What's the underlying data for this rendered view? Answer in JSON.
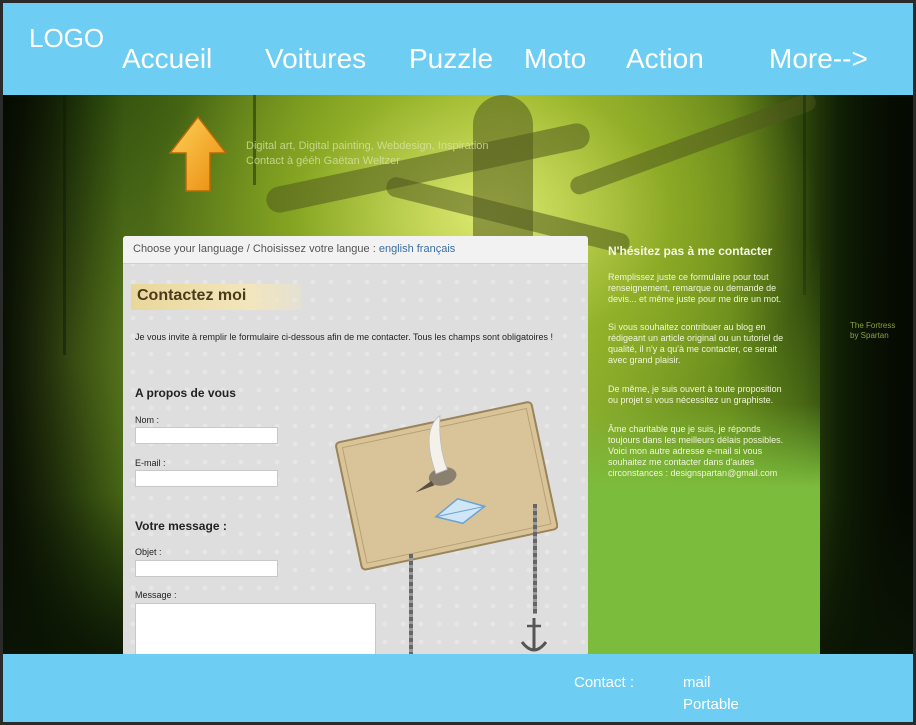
{
  "header": {
    "logo": "LOGO",
    "nav": [
      "Accueil",
      "Voitures",
      "Puzzle",
      "Moto",
      "Action",
      "More-->"
    ]
  },
  "hero": {
    "tagline_line1": "Digital art, Digital painting, Webdesign, Inspiration",
    "tagline_line2": "Contact à gééh Gaëtan Weltzer",
    "credit_line1": "The Fortress",
    "credit_line2": "by Spartan"
  },
  "panel": {
    "lang_prefix": "Choose your language / Choisissez votre langue :",
    "lang_english": "english",
    "lang_french": "français",
    "title": "Contactez moi",
    "intro": "Je vous invite à remplir le formulaire ci-dessous afin de me contacter. Tous les champs sont obligatoires !",
    "section_about": "A propos de vous",
    "label_nom": "Nom :",
    "label_email": "E-mail :",
    "section_message": "Votre message :",
    "label_objet": "Objet :",
    "label_message": "Message :"
  },
  "sidebar": {
    "title": "N'hésitez pas à me contacter",
    "p1": [
      "Remplissez juste ce formulaire pour tout",
      "renseignement, remarque ou demande de",
      "devis... et même juste pour me dire un mot."
    ],
    "p2": [
      "Si vous souhaitez contribuer au blog en",
      "rédigeant un article original ou un tutoriel de",
      "qualité, il n'y a qu'à me contacter, ce serait",
      "avec grand plaisir."
    ],
    "p3": [
      "De même, je suis ouvert à toute proposition",
      "ou projet si vous nécessitez un graphiste."
    ],
    "p4": [
      "Âme charitable que je suis, je réponds",
      "toujours dans les meilleurs délais possibles.",
      "Voici mon autre adresse e-mail si vous",
      "souhaitez me contacter dans d'autes",
      "circonstances : designspartan@gmail.com"
    ]
  },
  "footer": {
    "contact_label": "Contact :",
    "mail": "mail",
    "portable": "Portable"
  },
  "colors": {
    "bar": "#6ecdf3",
    "sidebar_green": "#7cbc3c"
  }
}
